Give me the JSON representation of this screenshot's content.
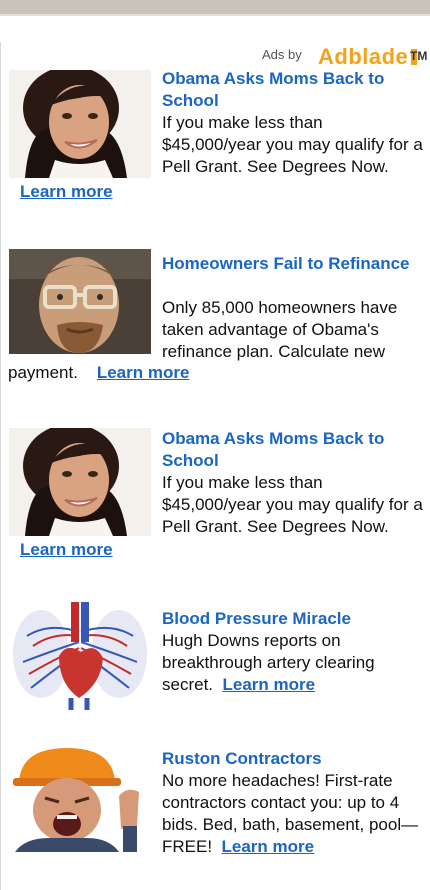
{
  "header": {
    "ads_by": "Ads by",
    "brand": "Adblade",
    "tm": "TM"
  },
  "ads": [
    {
      "title": "Obama Asks Moms Back to School",
      "body": "If you make less than $45,000/year you may qualify for a Pell Grant. See Degrees Now.",
      "learn": "Learn more",
      "image": "smiling-woman-photo"
    },
    {
      "title": "Homeowners Fail to Refinance",
      "body": "Only 85,000 homeowners have taken advantage of Obama's refinance plan. Calculate new",
      "tail": "payment.",
      "learn": "Learn more",
      "image": "man-with-glasses-photo"
    },
    {
      "title": "Obama Asks Moms Back to School",
      "body": "If you make less than $45,000/year you may qualify for a Pell Grant. See Degrees Now.",
      "learn": "Learn more",
      "image": "smiling-woman-photo"
    },
    {
      "title": "Blood Pressure Miracle",
      "body": "Hugh Downs reports on breakthrough artery clearing secret.",
      "learn": "Learn more",
      "image": "heart-anatomy-illustration"
    },
    {
      "title": "Ruston Contractors",
      "body": "No more headaches! First-rate contractors contact you: up to 4 bids. Bed, bath, basement, pool—FREE!",
      "learn": "Learn more",
      "image": "yelling-contractor-photo"
    }
  ]
}
